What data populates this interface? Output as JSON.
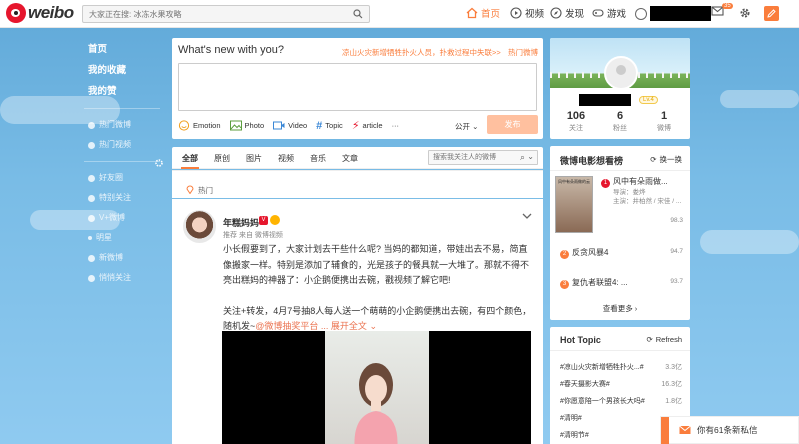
{
  "brand": {
    "logo_text": "weibo"
  },
  "search": {
    "placeholder": "大家正在搜: 冰冻水果攻略"
  },
  "nav": {
    "home": "首页",
    "video": "视频",
    "discover": "发现",
    "game": "游戏",
    "mail_badge": "35"
  },
  "sidebar": {
    "main": [
      "首页",
      "我的收藏",
      "我的赞"
    ],
    "hot": [
      "热门微博",
      "热门视频"
    ],
    "groups": [
      "好友圈",
      "特别关注",
      "V+微博",
      "明星",
      "新微博",
      "悄悄关注"
    ]
  },
  "publish": {
    "title": "What's new with you?",
    "trending_topic": "凉山火灾新增牺牲扑火人员，扑救过程中失联>>",
    "hot_link": "热门微博",
    "tools": [
      "Emotion",
      "Photo",
      "Video",
      "Topic",
      "article",
      "···"
    ],
    "visibility": "公开",
    "submit": "发布"
  },
  "feed": {
    "tabs": [
      "全部",
      "原创",
      "图片",
      "视频",
      "音乐",
      "文章"
    ],
    "search_placeholder": "搜索我关注人的微博",
    "hot_label": "热门"
  },
  "post": {
    "author": "年糕妈妈",
    "meta": "推荐 来自 微博视频",
    "body_1": "小长假要到了，大家计划去干些什么呢? 当妈的都知道，带娃出去不易，简直像搬家一样。特别是添加了辅食的，光是孩子的餐具就一大堆了。那就不得不亮出糕妈的神器了：小企鹅便携出去碗，戳视频了解它吧!",
    "body_2a": "关注+转发，4月7号抽8人每人送一个萌萌的小企鹅便携出去碗，有四个颜色，随机发~",
    "lottery_link": "@微博抽奖平台",
    "expand": "... 展开全文"
  },
  "profile": {
    "level": "Lv.4",
    "stats": [
      {
        "value": "106",
        "label": "关注"
      },
      {
        "value": "6",
        "label": "粉丝"
      },
      {
        "value": "1",
        "label": "微博"
      }
    ]
  },
  "movies": {
    "title": "微博电影想看榜",
    "refresh": "换一换",
    "poster_text": "风中有朵雨做的云",
    "top": {
      "rank": "1",
      "name": "风中有朵雨做...",
      "director": "导演：娄烨",
      "cast": "主演：井柏然 / 宋佳 / ...",
      "score": "98.3"
    },
    "items": [
      {
        "rank": "2",
        "name": "反贪风暴4",
        "score": "94.7"
      },
      {
        "rank": "3",
        "name": "复仇者联盟4: ...",
        "score": "93.7"
      }
    ],
    "more": "查看更多 ›"
  },
  "hot_topics": {
    "title": "Hot Topic",
    "refresh": "Refresh",
    "items": [
      {
        "name": "#凉山火灾新增牺牲扑火...#",
        "value": "3.3亿"
      },
      {
        "name": "#春天摄影大赛#",
        "value": "16.3亿"
      },
      {
        "name": "#你愿意陪一个男孩长大吗#",
        "value": "1.8亿"
      },
      {
        "name": "#清明#",
        "value": ""
      },
      {
        "name": "#清明节#",
        "value": ""
      }
    ]
  },
  "message": {
    "text": "你有61条新私信"
  },
  "colors": {
    "accent": "#fa7d3c",
    "brand_red": "#e6162d",
    "sky": "#79bce6"
  }
}
